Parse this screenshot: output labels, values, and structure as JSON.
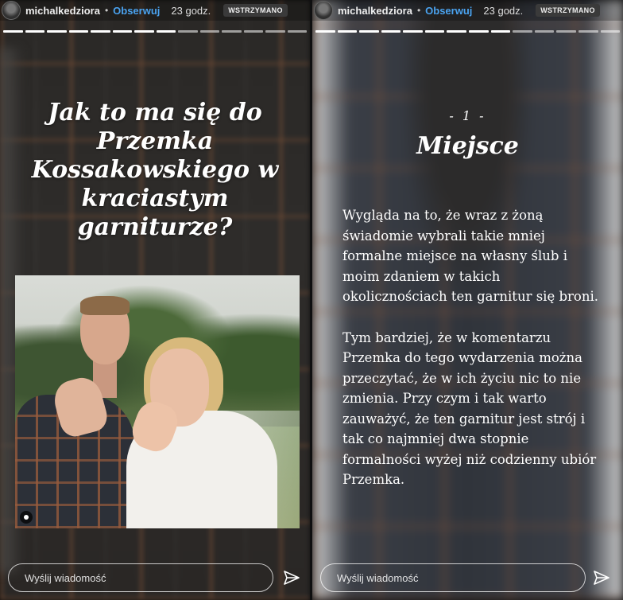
{
  "stories": [
    {
      "header": {
        "username": "michalkedziora",
        "separator": "•",
        "follow_label": "Obserwuj",
        "time": "23 godz.",
        "paused_label": "WSTRZYMANO"
      },
      "title": "Jak to ma się do Przemka Kossakowskiego w kraciastym garniturze?",
      "reply_placeholder": "Wyślij wiadomość"
    },
    {
      "header": {
        "username": "michalkedziora",
        "separator": "•",
        "follow_label": "Obserwuj",
        "time": "23 godz.",
        "paused_label": "WSTRZYMANO"
      },
      "number": "- 1 -",
      "title": "Miejsce",
      "paragraphs": [
        "Wygląda na to, że wraz z żoną świadomie wybrali takie mniej formalne miejsce na własny ślub i moim zdaniem w takich okolicznościach ten garnitur się broni.",
        "Tym bardziej, że w komentarzu Przemka do tego wydarzenia można przeczytać, że w ich życiu nic to nie zmienia. Przy czym i tak warto zauważyć, że ten garnitur jest strój i tak co najmniej dwa stopnie formalności wyżej niż codzienny ubiór Przemka."
      ],
      "reply_placeholder": "Wyślij wiadomość"
    }
  ],
  "icons": {
    "send": "paper-plane-icon",
    "avatar": "avatar",
    "tag": "user-tag-icon"
  },
  "colors": {
    "follow": "#4aa3f0",
    "paused_bg": "#3a3a3a"
  }
}
